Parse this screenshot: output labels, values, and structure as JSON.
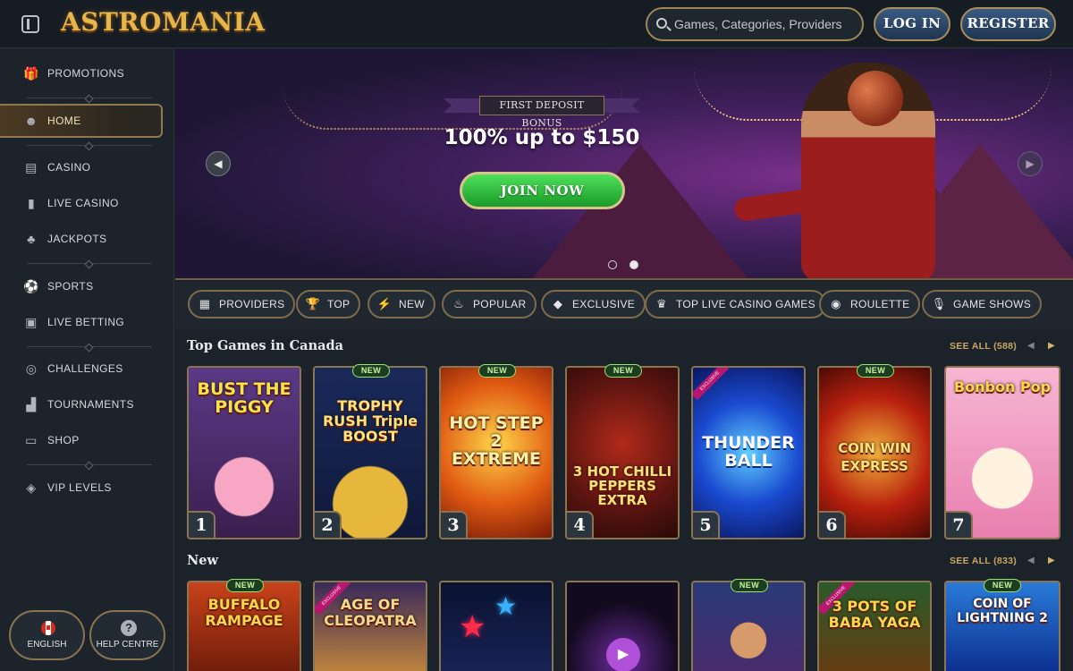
{
  "header": {
    "logo": "ASTROMANIA",
    "search_placeholder": "Games, Categories, Providers",
    "login_label": "LOG IN",
    "register_label": "REGISTER"
  },
  "sidebar": {
    "items": [
      {
        "label": "PROMOTIONS",
        "icon": "gift-icon"
      },
      {
        "label": "HOME",
        "icon": "home-icon",
        "active": true
      },
      {
        "label": "CASINO",
        "icon": "slot-machine-icon"
      },
      {
        "label": "LIVE CASINO",
        "icon": "card-icon"
      },
      {
        "label": "JACKPOTS",
        "icon": "clover-icon"
      },
      {
        "label": "SPORTS",
        "icon": "soccer-ball-icon"
      },
      {
        "label": "LIVE BETTING",
        "icon": "live-icon"
      },
      {
        "label": "CHALLENGES",
        "icon": "target-icon"
      },
      {
        "label": "TOURNAMENTS",
        "icon": "podium-icon"
      },
      {
        "label": "SHOP",
        "icon": "chest-icon"
      },
      {
        "label": "VIP LEVELS",
        "icon": "diamond-icon"
      }
    ],
    "language_label": "ENGLISH",
    "help_label": "HELP CENTRE",
    "help_icon_text": "?"
  },
  "hero": {
    "bonus_title": "FIRST DEPOSIT BONUS",
    "bonus_amount": "100% up to $150",
    "cta_label": "JOIN NOW",
    "prev_arrow": "◀",
    "next_arrow": "▶",
    "slides_total": 2,
    "active_slide": 2
  },
  "categories": [
    {
      "label": "PROVIDERS",
      "icon": "providers-icon",
      "glyph": "▦"
    },
    {
      "label": "TOP",
      "icon": "trophy-icon",
      "glyph": "🏆"
    },
    {
      "label": "NEW",
      "icon": "lightning-icon",
      "glyph": "⚡"
    },
    {
      "label": "POPULAR",
      "icon": "flame-icon",
      "glyph": "♨"
    },
    {
      "label": "EXCLUSIVE",
      "icon": "diamond-icon",
      "glyph": "◆"
    },
    {
      "label": "TOP LIVE CASINO GAMES",
      "icon": "crown-icon",
      "glyph": "♛"
    },
    {
      "label": "ROULETTE",
      "icon": "roulette-icon",
      "glyph": "◉"
    },
    {
      "label": "GAME SHOWS",
      "icon": "microphone-icon",
      "glyph": "🎙"
    }
  ],
  "top_games": {
    "title": "Top Games in Canada",
    "see_all": "SEE ALL (588)",
    "games": [
      {
        "name": "BUST THE PIGGY",
        "rank": "1",
        "new": false,
        "exclusive": false
      },
      {
        "name": "TROPHY RUSH Triple BOOST",
        "rank": "2",
        "new": true,
        "exclusive": false
      },
      {
        "name": "HOT STEP 2 EXTREME",
        "rank": "3",
        "new": true,
        "exclusive": false
      },
      {
        "name": "3 HOT CHILLI PEPPERS EXTRA",
        "rank": "4",
        "new": true,
        "exclusive": false
      },
      {
        "name": "THUNDER BALL",
        "rank": "5",
        "new": false,
        "exclusive": true
      },
      {
        "name": "COIN WIN EXPRESS",
        "rank": "6",
        "new": true,
        "exclusive": false
      },
      {
        "name": "Bonbon Pop",
        "rank": "7",
        "new": false,
        "exclusive": false
      }
    ]
  },
  "new_games": {
    "title": "New",
    "see_all": "SEE ALL (833)",
    "games": [
      {
        "name": "BUFFALO RAMPAGE",
        "new": true,
        "exclusive": false
      },
      {
        "name": "AGE OF CLEOPATRA",
        "new": false,
        "exclusive": true
      },
      {
        "name": "",
        "new": false,
        "exclusive": false
      },
      {
        "name": "",
        "new": false,
        "exclusive": false
      },
      {
        "name": "",
        "new": true,
        "exclusive": false
      },
      {
        "name": "3 POTS OF BABA YAGA",
        "new": false,
        "exclusive": true
      },
      {
        "name": "COIN OF LIGHTNING 2",
        "new": true,
        "exclusive": false
      }
    ]
  },
  "labels": {
    "new_badge": "NEW",
    "exclusive_badge": "EXCLUSIVE"
  },
  "colors": {
    "accent_gold": "#c9a85e",
    "join_green": "#2ec43e",
    "login_blue": "#2c4a6e"
  }
}
